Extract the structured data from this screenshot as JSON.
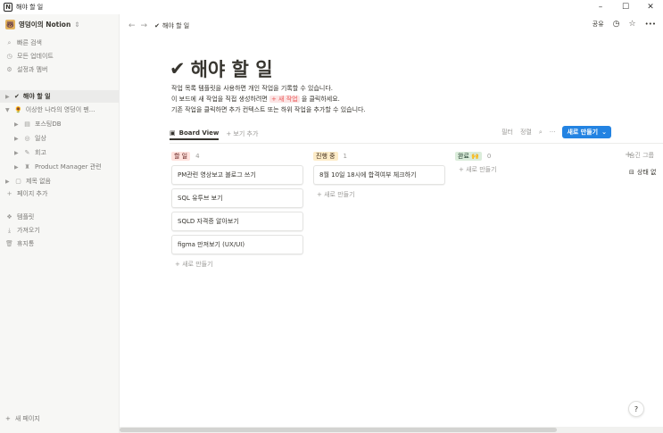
{
  "window": {
    "app_icon": "N",
    "title": "해야 할 일",
    "minimize": "–",
    "maximize": "☐",
    "close": "✕"
  },
  "sidebar": {
    "workspace": "영덩이의 Notion",
    "workspace_caret": "⇕",
    "quick_search": "빠른 검색",
    "updates": "모든 업데이트",
    "settings": "설정과 멤버",
    "pages": [
      {
        "label": "해야 할 일",
        "icon": "✔",
        "active": true,
        "depth": 0
      },
      {
        "label": "이상한 나라의 영덩이 펜...",
        "icon": "🌻",
        "depth": 0,
        "expanded": true
      },
      {
        "label": "포스팅DB",
        "icon": "▤",
        "depth": 1
      },
      {
        "label": "일상",
        "icon": "◎",
        "depth": 1
      },
      {
        "label": "회고",
        "icon": "✎",
        "depth": 1
      },
      {
        "label": "Product Manager 관련",
        "icon": "♜",
        "depth": 1
      },
      {
        "label": "제목 없음",
        "icon": "▢",
        "depth": 0
      }
    ],
    "add_page": "페이지 추가",
    "templates": "템플릿",
    "import": "가져오기",
    "trash": "휴지통",
    "new_page": "새 페이지"
  },
  "topbar": {
    "back": "←",
    "forward": "→",
    "crumb_icon": "✔",
    "crumb": "해야 할 일",
    "share": "공유",
    "history_icon": "clock-icon",
    "favorite_icon": "star-icon",
    "more": "•••"
  },
  "page": {
    "title_icon": "✔",
    "title": "해야 할 일",
    "desc_line1": "작업 목록 템플릿을 사용하면 개인 작업을 기록할 수 있습니다.",
    "desc_line2_a": "이 보드에 새 작업을 직접 생성하려면 ",
    "desc_line2_tag": "+ 새 작업",
    "desc_line2_b": " 을 클릭하세요.",
    "desc_line3": "기존 작업을 클릭하면 추가 컨텍스트 또는 하위 작업을 추가할 수 있습니다."
  },
  "views": {
    "active": "Board View",
    "add": "+ 보기 추가",
    "filter": "필터",
    "sort": "정렬",
    "search": "⌕",
    "more": "···",
    "new_button": "새로 만들기",
    "new_caret": "⌄"
  },
  "board": {
    "columns": [
      {
        "name": "할 일",
        "count": "4",
        "tag_color": "#ffe2dd",
        "text_color": "#5d1715",
        "cards": [
          "PM관련 영상보고 블로그 쓰기",
          "SQL 유투브 보기",
          "SQLD 자격증 알아보기",
          "figma 만져보기 (UX/UI)"
        ],
        "add": "+ 새로 만들기"
      },
      {
        "name": "진행 중",
        "count": "1",
        "tag_color": "#fdecc8",
        "text_color": "#402c1b",
        "cards": [
          "8월 10일 18시에 합격여부 체크하기"
        ],
        "add": "+ 새로 만들기"
      },
      {
        "name": "완료 🙌",
        "count": "0",
        "tag_color": "#dbeddb",
        "text_color": "#1c3829",
        "cards": [],
        "add": "+ 새로 만들기"
      }
    ],
    "add_column": "+",
    "hidden_groups": "숨긴 그룹",
    "hidden_status": "상태 없"
  },
  "help": "?"
}
